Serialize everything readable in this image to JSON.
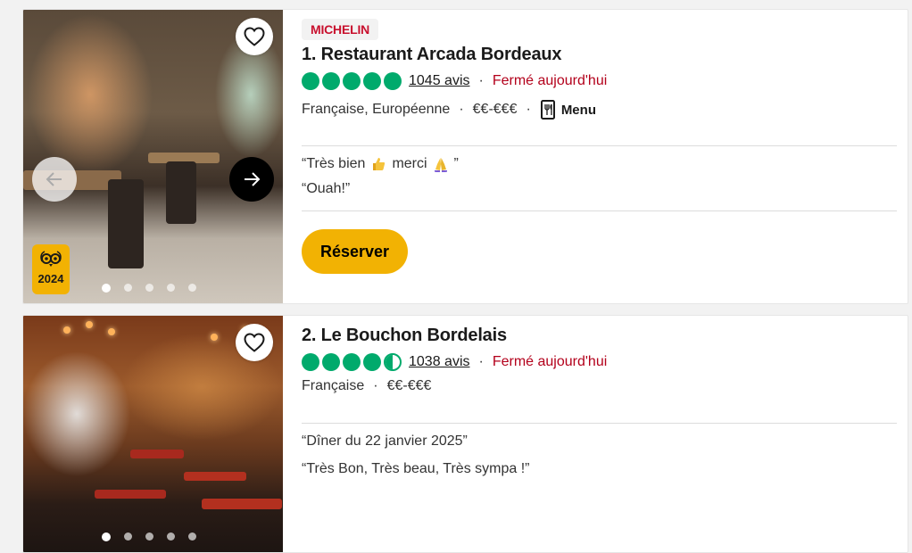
{
  "restaurants": [
    {
      "badge": "MICHELIN",
      "title": "1. Restaurant Arcada Bordeaux",
      "rating": 5.0,
      "reviews": "1045 avis",
      "status": "Fermé aujourd'hui",
      "cuisine": "Française, Européenne",
      "price": "€€-€€€",
      "menu_label": "Menu",
      "quotes": [
        "“Très bien",
        "merci",
        "”",
        "“Ouah!”"
      ],
      "cta": "Réserver",
      "award_year": "2024",
      "carousel": {
        "total": 5,
        "active": 1
      }
    },
    {
      "title": "2. Le Bouchon Bordelais",
      "rating": 4.5,
      "reviews": "1038 avis",
      "status": "Fermé aujourd'hui",
      "cuisine": "Française",
      "price": "€€-€€€",
      "quotes": [
        "“Dîner du 22 janvier 2025”",
        "“Très Bon, Très beau, Très sympa !”"
      ],
      "carousel": {
        "total": 5,
        "active": 1
      }
    }
  ],
  "separator": "·",
  "colors": {
    "rating_green": "#00aa6c",
    "closed_red": "#b3001b",
    "brand_yellow": "#f2b203",
    "michelin_red": "#c8102e"
  },
  "icons": [
    "heart-icon",
    "arrow-left-icon",
    "arrow-right-icon",
    "menu-book-icon",
    "thumbs-up-emoji",
    "pray-emoji",
    "travelers-choice-owl-icon"
  ]
}
